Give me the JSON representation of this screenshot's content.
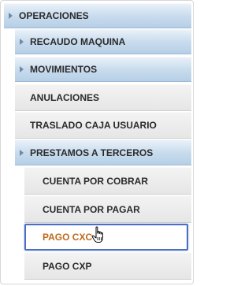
{
  "menu": {
    "items": [
      {
        "label": "OPERACIONES",
        "expandable": true
      },
      {
        "label": "RECAUDO MAQUINA",
        "expandable": true
      },
      {
        "label": "MOVIMIENTOS",
        "expandable": true
      },
      {
        "label": "ANULACIONES",
        "expandable": false
      },
      {
        "label": "TRASLADO CAJA USUARIO",
        "expandable": false
      },
      {
        "label": "PRESTAMOS A TERCEROS",
        "expandable": true
      },
      {
        "label": "CUENTA POR COBRAR",
        "expandable": false
      },
      {
        "label": "CUENTA POR PAGAR",
        "expandable": false
      },
      {
        "label": "PAGO CXC",
        "expandable": false,
        "selected": true
      },
      {
        "label": "PAGO CXP",
        "expandable": false
      }
    ]
  },
  "colors": {
    "selected_text": "#c06a1c",
    "selected_border": "#4a6fc2",
    "header_gradient_top": "#e9f1f8",
    "header_gradient_bottom": "#b6cfe6",
    "arrow": "#6f8aa6"
  },
  "icons": {
    "expand": "triangle-right-icon",
    "cursor": "hand-pointer-icon"
  }
}
